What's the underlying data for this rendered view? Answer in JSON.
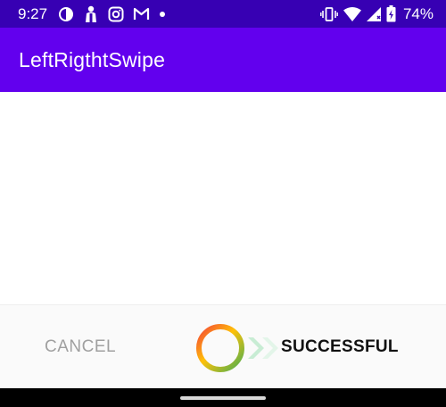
{
  "status_bar": {
    "time": "9:27",
    "left_icons": [
      "notification-app-icon",
      "person-icon",
      "instagram-icon",
      "gmail-icon",
      "dot-icon"
    ],
    "right_icons": [
      "vibrate-icon",
      "wifi-icon",
      "cell-signal-icon",
      "battery-icon"
    ],
    "battery_percent": "74%",
    "background": "#3700b3"
  },
  "app_bar": {
    "title": "LeftRigthtSwipe",
    "background": "#6200ee"
  },
  "swipe_control": {
    "cancel_label": "CANCEL",
    "success_label": "SUCCESSFUL",
    "knob_gradient": [
      "#f44336",
      "#ffc107",
      "#4caf50"
    ],
    "arrow_color": "#c8ecd4"
  },
  "nav_bar": {
    "background": "#000000"
  }
}
